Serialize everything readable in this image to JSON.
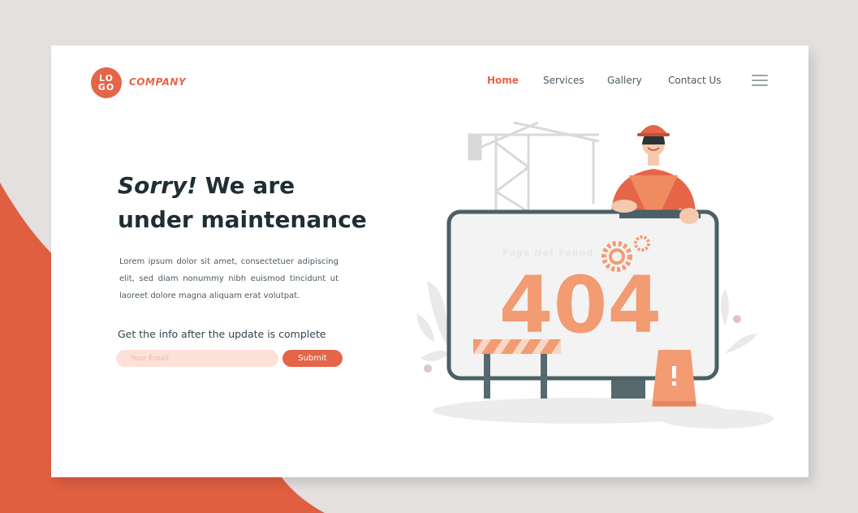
{
  "brand": {
    "logo_text": "LOGO",
    "company": "COMPANY",
    "accent_color": "#e46548"
  },
  "nav": {
    "home": "Home",
    "services": "Services",
    "gallery": "Gallery",
    "contact": "Contact Us",
    "menu_icon": "hamburger-icon"
  },
  "hero": {
    "headline_em": "Sorry!",
    "headline_rest": " We are",
    "headline_line2": "under maintenance",
    "body": "Lorem ipsum dolor sit amet, consectetuer adipiscing elit, sed diam nonummy nibh euismod tincidunt ut laoreet dolore magna aliquam erat volutpat.",
    "info": "Get the info after the update is complete",
    "email_placeholder": "Your Email",
    "submit_label": "Submit"
  },
  "illustration": {
    "screen_caption": "Page Not Found",
    "error_code": "404",
    "colors": {
      "screen_border": "#4b5f66",
      "code": "#f39b72",
      "worker_vest": "#e46548"
    }
  }
}
